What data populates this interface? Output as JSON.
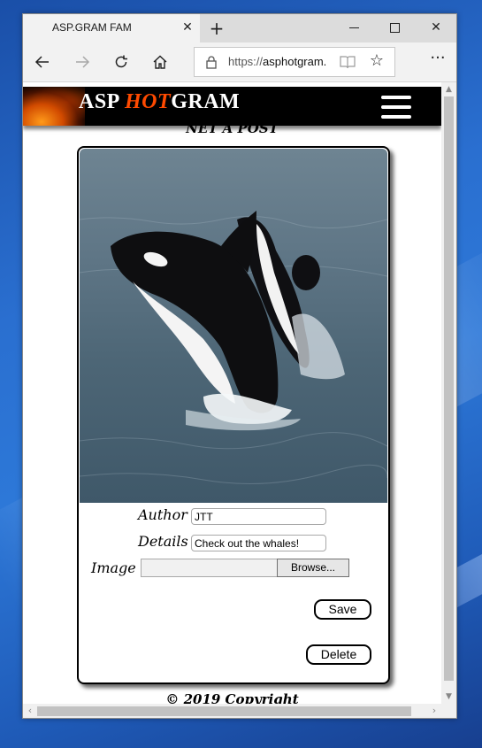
{
  "browser": {
    "tab_title": "ASP.GRAM FAM",
    "url_prefix": "https://",
    "url_host": "asphotgram.",
    "icons": [
      "back-icon",
      "forward-icon",
      "refresh-icon",
      "home-icon",
      "lock-icon",
      "reader-view-icon",
      "favorite-star-icon",
      "more-icon",
      "close-icon",
      "new-tab-icon"
    ]
  },
  "site": {
    "brand_left": "ASP ",
    "brand_hot": "HOT",
    "brand_right": "GRAM",
    "menu_icon": "hamburger-menu-icon",
    "accent": "#ff4a00"
  },
  "page": {
    "heading": "NET A POST",
    "photo_alt": "orca-photo"
  },
  "form": {
    "author_label": "Author",
    "author_value": "JTT",
    "details_label": "Details",
    "details_value": "Check out the whales!",
    "image_label": "Image",
    "browse_label": "Browse...",
    "save_label": "Save",
    "delete_label": "Delete"
  },
  "footer": {
    "text": "© 2019 Copyright"
  }
}
